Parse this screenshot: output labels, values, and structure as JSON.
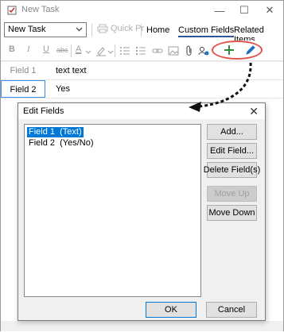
{
  "window": {
    "title": "New Task"
  },
  "toolbar": {
    "template_value": "New Task",
    "quick_print_label": "Quick Pr",
    "tabs": [
      {
        "label": "Home"
      },
      {
        "label": "Custom Fields"
      },
      {
        "label": "Related Items"
      }
    ],
    "bold": "B",
    "italic": "I",
    "underline": "U",
    "strike": "abc",
    "font_color": "A"
  },
  "fields": [
    {
      "label": "Field 1",
      "value": "text text"
    },
    {
      "label": "Field 2",
      "value": "Yes"
    }
  ],
  "dialog": {
    "title": "Edit Fields",
    "items": [
      "Field 1  (Text)",
      "Field 2  (Yes/No)"
    ],
    "selected_index": 0,
    "buttons": {
      "add": "Add...",
      "edit": "Edit Field...",
      "delete": "Delete Field(s)",
      "move_up": "Move Up",
      "move_down": "Move Down",
      "ok": "OK",
      "cancel": "Cancel"
    }
  },
  "colors": {
    "accent": "#0078d7",
    "highlight_ring": "#e0524a",
    "plus": "#2e8b3a",
    "pen": "#1f6fc5"
  }
}
